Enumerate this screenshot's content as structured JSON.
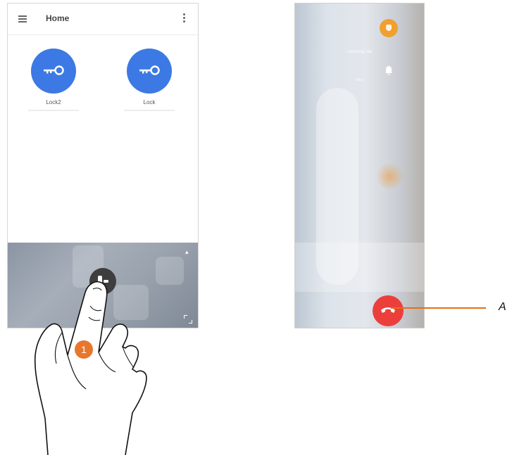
{
  "left_phone": {
    "title": "Home",
    "locks": [
      {
        "name": "Lock2"
      },
      {
        "name": "Lock"
      }
    ]
  },
  "instruction": {
    "step_number": "1"
  },
  "right_phone": {
    "caller_label": "Incoming call",
    "bell_label": "Ring"
  },
  "callout": {
    "label": "A"
  },
  "colors": {
    "lock_button": "#3c79e4",
    "hangup_button": "#ec3f3c",
    "step_badge": "#e8772e",
    "callout_line": "#e07018"
  }
}
